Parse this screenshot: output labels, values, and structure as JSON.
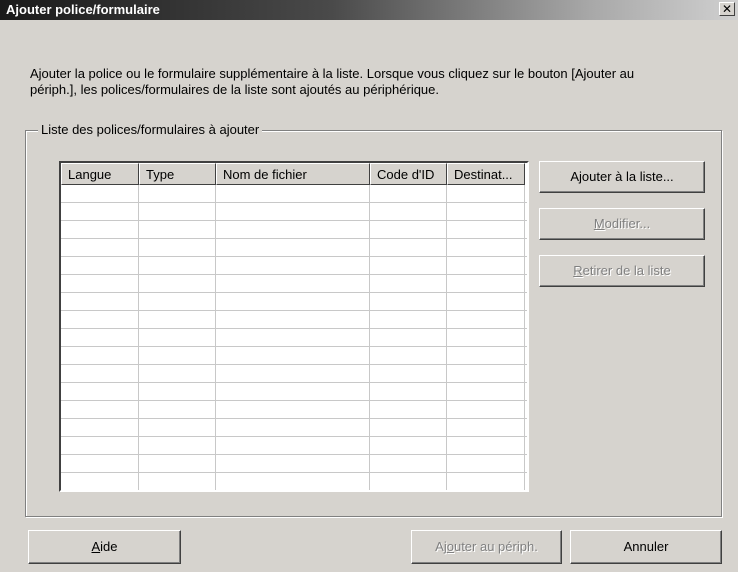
{
  "window": {
    "title": "Ajouter police/formulaire",
    "close_glyph": "✕"
  },
  "description": {
    "line1": "Ajouter la police ou le formulaire supplémentaire à la liste. Lorsque vous cliquez sur le bouton [Ajouter au",
    "line2": "périph.], les polices/formulaires de la liste sont ajoutés au périphérique."
  },
  "group": {
    "label": "Liste des polices/formulaires à ajouter"
  },
  "list": {
    "columns": [
      "Langue",
      "Type",
      "Nom de fichier",
      "Code d'ID",
      "Destinat..."
    ],
    "rows": []
  },
  "side_buttons": {
    "add_to_list": {
      "pre": "A",
      "accel": "j",
      "post": "outer à la liste...",
      "enabled": true
    },
    "modify": {
      "pre": "",
      "accel": "M",
      "post": "odifier...",
      "enabled": false
    },
    "remove": {
      "pre": "",
      "accel": "R",
      "post": "etirer de la liste",
      "enabled": false
    }
  },
  "bottom_buttons": {
    "help": {
      "pre": "",
      "accel": "A",
      "post": "ide",
      "enabled": true
    },
    "add_to_device": {
      "pre": "Aj",
      "accel": "o",
      "post": "uter au périph.",
      "enabled": false
    },
    "cancel": {
      "label": "Annuler",
      "enabled": true
    }
  },
  "colors": {
    "dialog_bg": "#d6d3ce",
    "title_text": "#ffffff",
    "disabled_text": "#808080"
  }
}
